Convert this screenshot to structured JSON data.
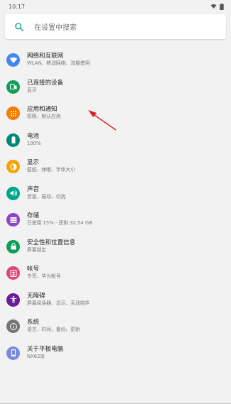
{
  "status_bar": {
    "time": "10:17"
  },
  "search": {
    "placeholder": "在设置中搜索"
  },
  "items": [
    {
      "title": "网络和互联网",
      "subtitle": "WLAN、移动网络、流量使用",
      "color": "#4285f4",
      "icon": "wifi-icon"
    },
    {
      "title": "已连接的设备",
      "subtitle": "蓝牙",
      "color": "#0f9d58",
      "icon": "devices-icon"
    },
    {
      "title": "应用和通知",
      "subtitle": "权限、默认应用",
      "color": "#f57c00",
      "icon": "apps-icon"
    },
    {
      "title": "电池",
      "subtitle": "100%",
      "color": "#00897b",
      "icon": "battery-icon"
    },
    {
      "title": "显示",
      "subtitle": "壁纸、休眠、字体大小",
      "color": "#f4a300",
      "icon": "brightness-icon"
    },
    {
      "title": "声音",
      "subtitle": "音量、振动、勿扰",
      "color": "#00a58e",
      "icon": "volume-icon"
    },
    {
      "title": "存储",
      "subtitle": "已使用 15% - 还剩 32.54 GB",
      "color": "#8e44c6",
      "icon": "storage-icon"
    },
    {
      "title": "安全性和位置信息",
      "subtitle": "屏幕锁定",
      "color": "#0f9d58",
      "icon": "lock-icon"
    },
    {
      "title": "帐号",
      "subtitle": "专荒、华为帐号",
      "color": "#e0457b",
      "icon": "account-icon"
    },
    {
      "title": "无障碍",
      "subtitle": "屏幕阅读器、显示、互动控件",
      "color": "#6a1b9a",
      "icon": "accessibility-icon"
    },
    {
      "title": "系统",
      "subtitle": "语言、时间、备份、更新",
      "color": "#757575",
      "icon": "info-icon"
    },
    {
      "title": "关于平板电脑",
      "subtitle": "NX629J",
      "color": "#7b8bdb",
      "icon": "tablet-icon"
    }
  ]
}
